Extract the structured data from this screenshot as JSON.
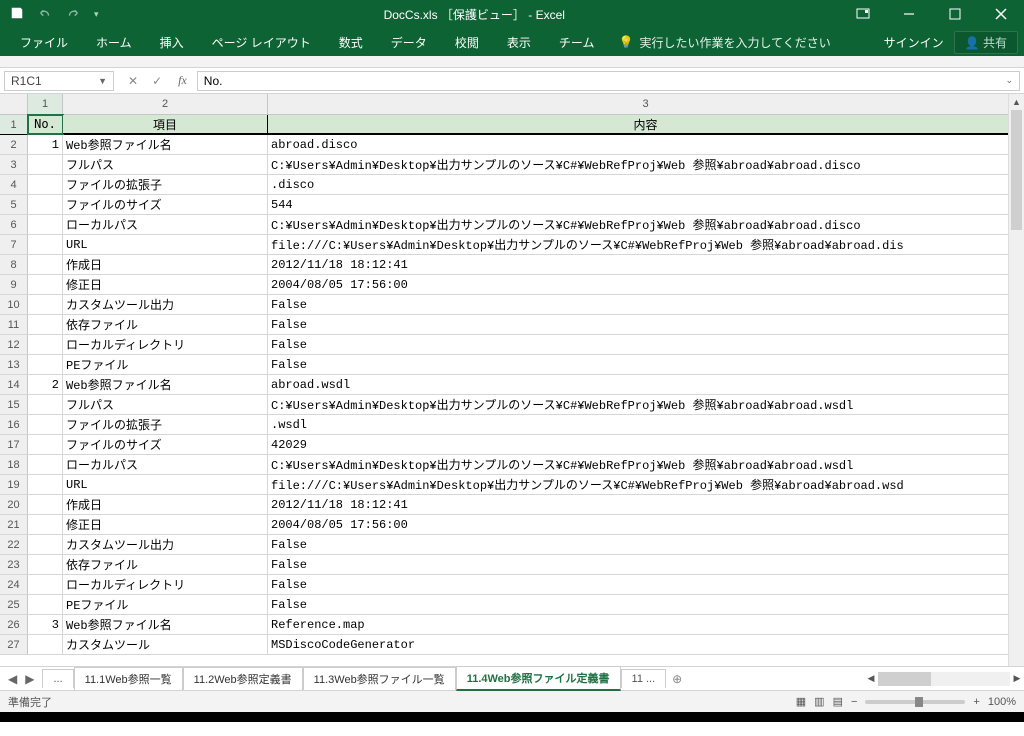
{
  "title": "DocCs.xls ［保護ビュー］ - Excel",
  "ribbon": {
    "file": "ファイル",
    "home": "ホーム",
    "insert": "挿入",
    "layout": "ページ レイアウト",
    "formulas": "数式",
    "data": "データ",
    "review": "校閲",
    "view": "表示",
    "team": "チーム",
    "tellme": "実行したい作業を入力してください",
    "signin": "サインイン",
    "share": "共有"
  },
  "namebox": "R1C1",
  "formula": "No.",
  "formula_expand": "⌄",
  "colheads": {
    "c1": "1",
    "c2": "2",
    "c3": "3"
  },
  "header": {
    "no": "No.",
    "item": "項目",
    "val": "内容"
  },
  "rows": [
    {
      "r": "2",
      "no": "1",
      "item": "Web参照ファイル名",
      "val": "abroad.disco"
    },
    {
      "r": "3",
      "no": "",
      "item": "フルパス",
      "val": "C:¥Users¥Admin¥Desktop¥出力サンプルのソース¥C#¥WebRefProj¥Web 参照¥abroad¥abroad.disco"
    },
    {
      "r": "4",
      "no": "",
      "item": "ファイルの拡張子",
      "val": ".disco"
    },
    {
      "r": "5",
      "no": "",
      "item": "ファイルのサイズ",
      "val": "544"
    },
    {
      "r": "6",
      "no": "",
      "item": "ローカルパス",
      "val": "C:¥Users¥Admin¥Desktop¥出力サンプルのソース¥C#¥WebRefProj¥Web 参照¥abroad¥abroad.disco"
    },
    {
      "r": "7",
      "no": "",
      "item": "URL",
      "val": "file:///C:¥Users¥Admin¥Desktop¥出力サンプルのソース¥C#¥WebRefProj¥Web 参照¥abroad¥abroad.dis"
    },
    {
      "r": "8",
      "no": "",
      "item": "作成日",
      "val": "2012/11/18 18:12:41"
    },
    {
      "r": "9",
      "no": "",
      "item": "修正日",
      "val": "2004/08/05 17:56:00"
    },
    {
      "r": "10",
      "no": "",
      "item": "カスタムツール出力",
      "val": "False"
    },
    {
      "r": "11",
      "no": "",
      "item": "依存ファイル",
      "val": "False"
    },
    {
      "r": "12",
      "no": "",
      "item": "ローカルディレクトリ",
      "val": "False"
    },
    {
      "r": "13",
      "no": "",
      "item": "PEファイル",
      "val": "False"
    },
    {
      "r": "14",
      "no": "2",
      "item": "Web参照ファイル名",
      "val": "abroad.wsdl"
    },
    {
      "r": "15",
      "no": "",
      "item": "フルパス",
      "val": "C:¥Users¥Admin¥Desktop¥出力サンプルのソース¥C#¥WebRefProj¥Web 参照¥abroad¥abroad.wsdl"
    },
    {
      "r": "16",
      "no": "",
      "item": "ファイルの拡張子",
      "val": ".wsdl"
    },
    {
      "r": "17",
      "no": "",
      "item": "ファイルのサイズ",
      "val": "42029"
    },
    {
      "r": "18",
      "no": "",
      "item": "ローカルパス",
      "val": "C:¥Users¥Admin¥Desktop¥出力サンプルのソース¥C#¥WebRefProj¥Web 参照¥abroad¥abroad.wsdl"
    },
    {
      "r": "19",
      "no": "",
      "item": "URL",
      "val": "file:///C:¥Users¥Admin¥Desktop¥出力サンプルのソース¥C#¥WebRefProj¥Web 参照¥abroad¥abroad.wsd"
    },
    {
      "r": "20",
      "no": "",
      "item": "作成日",
      "val": "2012/11/18 18:12:41"
    },
    {
      "r": "21",
      "no": "",
      "item": "修正日",
      "val": "2004/08/05 17:56:00"
    },
    {
      "r": "22",
      "no": "",
      "item": "カスタムツール出力",
      "val": "False"
    },
    {
      "r": "23",
      "no": "",
      "item": "依存ファイル",
      "val": "False"
    },
    {
      "r": "24",
      "no": "",
      "item": "ローカルディレクトリ",
      "val": "False"
    },
    {
      "r": "25",
      "no": "",
      "item": "PEファイル",
      "val": "False"
    },
    {
      "r": "26",
      "no": "3",
      "item": "Web参照ファイル名",
      "val": "Reference.map"
    },
    {
      "r": "27",
      "no": "",
      "item": "カスタムツール",
      "val": "MSDiscoCodeGenerator"
    }
  ],
  "sheets": {
    "ellipsis": "...",
    "s1": "11.1Web参照一覧",
    "s2": "11.2Web参照定義書",
    "s3": "11.3Web参照ファイル一覧",
    "s4": "11.4Web参照ファイル定義書",
    "s5": "11 ..."
  },
  "status": {
    "ready": "準備完了",
    "zoom": "100%"
  }
}
